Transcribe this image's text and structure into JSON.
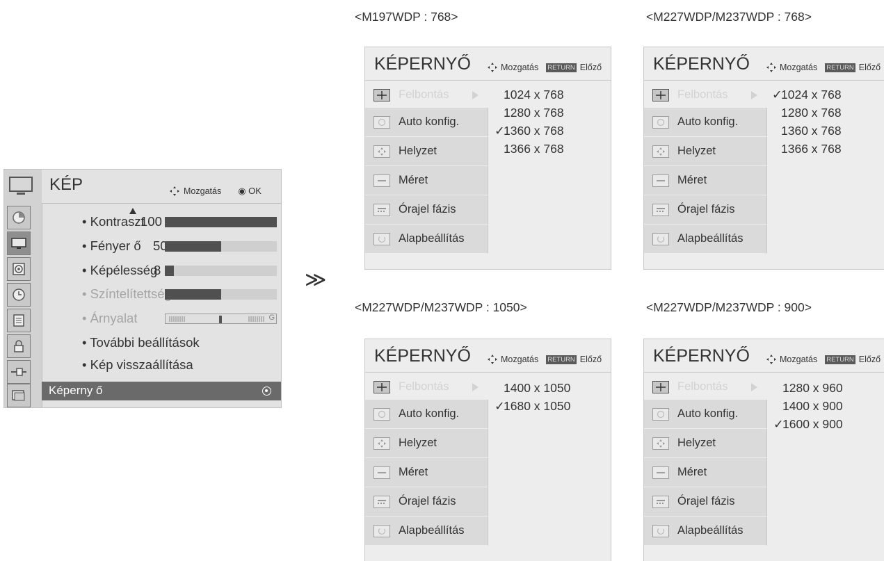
{
  "kep_menu": {
    "title": "KÉP",
    "hint_move": "Mozgatás",
    "hint_ok": "OK",
    "items": [
      {
        "label": "• Kontraszt",
        "value": "100",
        "level": 1.0,
        "dim": false
      },
      {
        "label": "• Fényer ő",
        "value": "50",
        "level": 0.5,
        "dim": false
      },
      {
        "label": "• Képélesség",
        "value": "8",
        "level": 0.08,
        "dim": false
      },
      {
        "label": "• Színtelítettség 50",
        "value": "",
        "level": 0.5,
        "dim": true
      },
      {
        "label": "• Árnyalat",
        "value": "0",
        "level": 0.0,
        "dim": true
      },
      {
        "label": "• További beállítások",
        "value": "",
        "level": null,
        "dim": false
      },
      {
        "label": "• Kép visszaállítása",
        "value": "",
        "level": null,
        "dim": false
      }
    ],
    "selected_item": "Képerny ő",
    "tint_end_label": "G"
  },
  "colors": {
    "bar_fill": "#505050",
    "bar_bg": "#cfcfcf",
    "selected_bg": "#6a6a6a",
    "panel_bg": "#ededed"
  },
  "panels": [
    {
      "caption": "<M197WDP : 768>",
      "title": "KÉPERNYŐ",
      "hint_move": "Mozgatás",
      "return_label": "RETURN",
      "prev_label": "Előző",
      "menu": [
        "Felbontás",
        "Auto konfig.",
        "Helyzet",
        "Méret",
        "Órajel fázis",
        "Alapbeállítás"
      ],
      "options": [
        {
          "label": "1024 x 768",
          "checked": false
        },
        {
          "label": "1280 x 768",
          "checked": false
        },
        {
          "label": "1360 x 768",
          "checked": true
        },
        {
          "label": "1366 x 768",
          "checked": false
        }
      ]
    },
    {
      "caption": "<M227WDP/M237WDP : 768>",
      "title": "KÉPERNYŐ",
      "hint_move": "Mozgatás",
      "return_label": "RETURN",
      "prev_label": "Előző",
      "menu": [
        "Felbontás",
        "Auto konfig.",
        "Helyzet",
        "Méret",
        "Órajel fázis",
        "Alapbeállítás"
      ],
      "options": [
        {
          "label": "1024 x 768",
          "checked": true
        },
        {
          "label": "1280 x 768",
          "checked": false
        },
        {
          "label": "1360 x 768",
          "checked": false
        },
        {
          "label": "1366 x 768",
          "checked": false
        }
      ]
    },
    {
      "caption": "<M227WDP/M237WDP : 1050>",
      "title": "KÉPERNYŐ",
      "hint_move": "Mozgatás",
      "return_label": "RETURN",
      "prev_label": "Előző",
      "menu": [
        "Felbontás",
        "Auto konfig.",
        "Helyzet",
        "Méret",
        "Órajel fázis",
        "Alapbeállítás"
      ],
      "options": [
        {
          "label": "1400 x 1050",
          "checked": false
        },
        {
          "label": "1680 x 1050",
          "checked": true
        }
      ]
    },
    {
      "caption": "<M227WDP/M237WDP : 900>",
      "title": "KÉPERNYŐ",
      "hint_move": "Mozgatás",
      "return_label": "RETURN",
      "prev_label": "Előző",
      "menu": [
        "Felbontás",
        "Auto konfig.",
        "Helyzet",
        "Méret",
        "Órajel fázis",
        "Alapbeállítás"
      ],
      "options": [
        {
          "label": "1280 x 960",
          "checked": false
        },
        {
          "label": "1400 x 900",
          "checked": false
        },
        {
          "label": "1600 x 900",
          "checked": true
        }
      ]
    }
  ],
  "check_mark": "✓"
}
